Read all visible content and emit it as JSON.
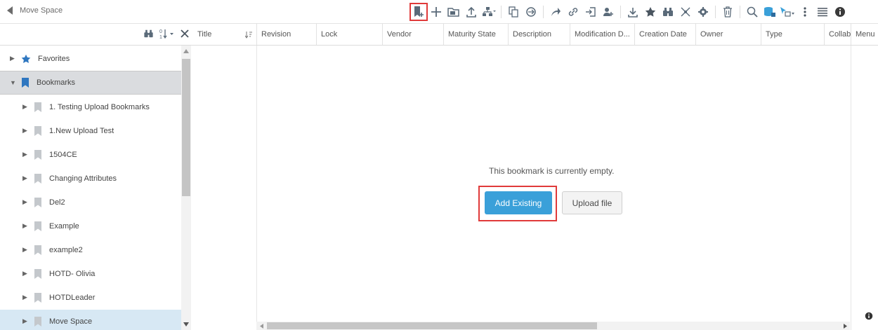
{
  "header": {
    "back_label": "Move Space"
  },
  "toolbar": {
    "icons": [
      "add-bookmark-icon",
      "plus-icon",
      "folder-add-icon",
      "upload-icon",
      "structure-icon",
      "copy-icon",
      "sync-icon",
      "share-icon",
      "link-icon",
      "import-icon",
      "users-icon",
      "download-icon",
      "star-icon",
      "binoculars-icon",
      "tools-icon",
      "settings-icon",
      "trash-icon",
      "search-icon",
      "collaboration-icon",
      "select-icon",
      "more-icon",
      "list-icon",
      "info-icon"
    ]
  },
  "tree_header": {
    "icons": [
      "binoculars-icon",
      "sort-icon",
      "close-icon"
    ]
  },
  "columns": [
    "Title",
    "Revision",
    "Lock",
    "Vendor",
    "Maturity State",
    "Description",
    "Modification D...",
    "Creation Date",
    "Owner",
    "Type",
    "Collabo",
    "Menu"
  ],
  "tree": [
    {
      "label": "Favorites",
      "icon": "star-icon"
    },
    {
      "label": "Bookmarks",
      "icon": "bookmark-icon"
    },
    {
      "label": "1. Testing Upload Bookmarks",
      "icon": "bookmark-icon"
    },
    {
      "label": "1.New Upload Test",
      "icon": "bookmark-icon"
    },
    {
      "label": "1504CE",
      "icon": "bookmark-icon"
    },
    {
      "label": "Changing Attributes",
      "icon": "bookmark-icon"
    },
    {
      "label": "Del2",
      "icon": "bookmark-icon"
    },
    {
      "label": "Example",
      "icon": "bookmark-icon"
    },
    {
      "label": "example2",
      "icon": "bookmark-icon"
    },
    {
      "label": "HOTD- Olivia",
      "icon": "bookmark-icon"
    },
    {
      "label": "HOTDLeader",
      "icon": "bookmark-icon"
    },
    {
      "label": "Move Space",
      "icon": "bookmark-icon"
    }
  ],
  "main": {
    "empty_message": "This bookmark is currently empty.",
    "add_existing": "Add Existing",
    "upload_file": "Upload file"
  },
  "colors": {
    "accent": "#3aa0d9",
    "highlight": "#e03a3a",
    "bookmark": "#2f77c0",
    "star": "#2f77c0"
  }
}
